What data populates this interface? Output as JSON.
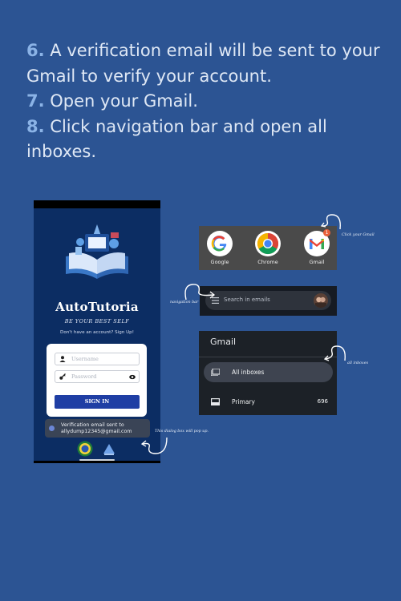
{
  "steps": [
    {
      "num": "6.",
      "text": "A verification email will be sent to your Gmail to verify your account."
    },
    {
      "num": "7.",
      "text": "Open your Gmail."
    },
    {
      "num": "8.",
      "text": "Click navigation bar and open all inboxes."
    }
  ],
  "phone": {
    "brand": "AutoTutoria",
    "slogan": "BE YOUR BEST SELF",
    "signup_text": "Don't have an account? Sign Up!",
    "username_placeholder": "Username",
    "password_placeholder": "Password",
    "signin_label": "SIGN IN",
    "toast_line1": "Verification email sent to",
    "toast_line2": "allydump12345@gmail.com"
  },
  "apps": [
    {
      "label": "Google",
      "icon": "google-icon"
    },
    {
      "label": "Chrome",
      "icon": "chrome-icon"
    },
    {
      "label": "Gmail",
      "icon": "gmail-icon",
      "badge": "1"
    }
  ],
  "search": {
    "placeholder": "Search in emails"
  },
  "gmail": {
    "title": "Gmail",
    "items": [
      {
        "label": "All inboxes",
        "count": ""
      },
      {
        "label": "Primary",
        "count": "696"
      }
    ]
  },
  "notes": {
    "click_gmail": "Click your Gmail",
    "navigation_bar": "navigation bar",
    "all_inboxes": "all inboxes",
    "dialog": "This dialog box will pop up."
  },
  "colors": {
    "background": "#2c5493",
    "step_number": "#8bb3e6",
    "signin_button": "#1f3ea4"
  }
}
